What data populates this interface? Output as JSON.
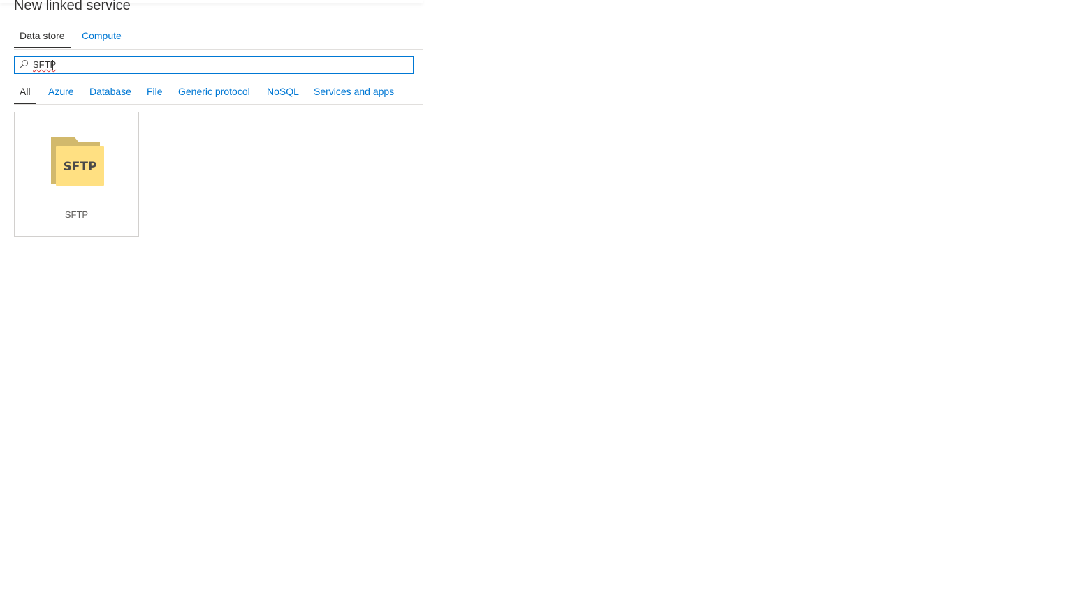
{
  "dialog": {
    "title": "New linked service"
  },
  "tabs": [
    {
      "label": "Data store",
      "active": true
    },
    {
      "label": "Compute",
      "active": false
    }
  ],
  "search": {
    "value": "SFTP",
    "icon": "search-icon"
  },
  "filters": [
    {
      "label": "All",
      "active": true
    },
    {
      "label": "Azure",
      "active": false
    },
    {
      "label": "Database",
      "active": false
    },
    {
      "label": "File",
      "active": false
    },
    {
      "label": "Generic protocol",
      "active": false
    },
    {
      "label": "NoSQL",
      "active": false
    },
    {
      "label": "Services and apps",
      "active": false
    }
  ],
  "results": [
    {
      "label": "SFTP",
      "icon": "folder-icon",
      "icon_text": "SFTP",
      "icon_color_back": "#d2b96c",
      "icon_color_front": "#ffe082"
    }
  ],
  "colors": {
    "accent": "#0078d4",
    "text": "#323130",
    "divider": "#e1dfdd"
  }
}
